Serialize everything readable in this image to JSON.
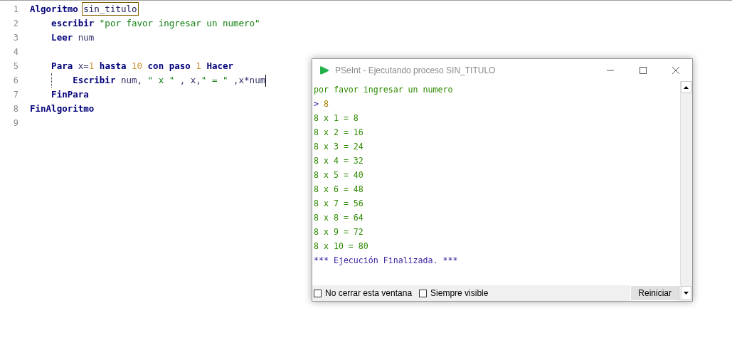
{
  "editor": {
    "lines": [
      {
        "number": "1",
        "tokens": [
          {
            "kind": "keyword",
            "text": "Algoritmo "
          },
          {
            "kind": "match",
            "text": "sin_titulo"
          }
        ]
      },
      {
        "number": "2",
        "tokens": [
          {
            "kind": "keyword",
            "text": "    escribir "
          },
          {
            "kind": "string",
            "text": "\"por favor ingresar un numero\""
          }
        ]
      },
      {
        "number": "3",
        "tokens": [
          {
            "kind": "keyword",
            "text": "    Leer"
          },
          {
            "kind": "plain",
            "text": " num"
          }
        ]
      },
      {
        "number": "4"
      },
      {
        "number": "5",
        "tokens": [
          {
            "kind": "keyword",
            "text": "    Para"
          },
          {
            "kind": "plain",
            "text": " x="
          },
          {
            "kind": "number",
            "text": "1"
          },
          {
            "kind": "keyword",
            "text": " hasta"
          },
          {
            "kind": "number",
            "text": " 10"
          },
          {
            "kind": "keyword",
            "text": " con paso"
          },
          {
            "kind": "number",
            "text": " 1"
          },
          {
            "kind": "keyword",
            "text": " Hacer"
          }
        ]
      },
      {
        "number": "6",
        "indent_guide": true,
        "cursor": true,
        "tokens": [
          {
            "kind": "keyword",
            "text": "        Escribir"
          },
          {
            "kind": "plain",
            "text": " num, "
          },
          {
            "kind": "string",
            "text": "\" x \""
          },
          {
            "kind": "plain",
            "text": " , x,"
          },
          {
            "kind": "string",
            "text": "\" = \""
          },
          {
            "kind": "plain",
            "text": " ,x*num"
          }
        ]
      },
      {
        "number": "7",
        "tokens": [
          {
            "kind": "keyword",
            "text": "    FinPara"
          }
        ]
      },
      {
        "number": "8",
        "tokens": [
          {
            "kind": "keyword",
            "text": "FinAlgoritmo"
          }
        ]
      },
      {
        "number": "9"
      }
    ]
  },
  "run_window": {
    "title": "PSeInt - Ejecutando proceso SIN_TITULO",
    "console": [
      {
        "kind": "output",
        "text": "por favor ingresar un numero"
      },
      {
        "kind": "input",
        "prompt": ">",
        "text": "8"
      },
      {
        "kind": "output",
        "text": "8 x 1 = 8"
      },
      {
        "kind": "output",
        "text": "8 x 2 = 16"
      },
      {
        "kind": "output",
        "text": "8 x 3 = 24"
      },
      {
        "kind": "output",
        "text": "8 x 4 = 32"
      },
      {
        "kind": "output",
        "text": "8 x 5 = 40"
      },
      {
        "kind": "output",
        "text": "8 x 6 = 48"
      },
      {
        "kind": "output",
        "text": "8 x 7 = 56"
      },
      {
        "kind": "output",
        "text": "8 x 8 = 64"
      },
      {
        "kind": "output",
        "text": "8 x 9 = 72"
      },
      {
        "kind": "output",
        "text": "8 x 10 = 80"
      },
      {
        "kind": "end",
        "text": "*** Ejecución Finalizada. ***"
      }
    ],
    "options": [
      {
        "label": "No cerrar esta ventana",
        "checked": false
      },
      {
        "label": "Siempre visible",
        "checked": false
      }
    ],
    "button": "Reiniciar"
  }
}
